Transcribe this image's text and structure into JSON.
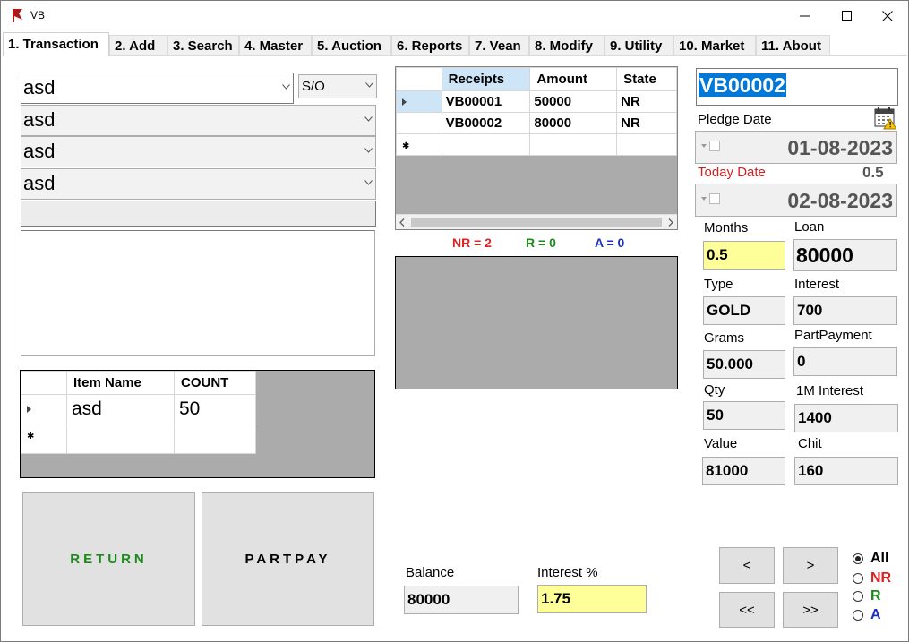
{
  "window": {
    "title": "VB",
    "minimize_glyph": "—",
    "maximize_glyph": "☐",
    "close_glyph": "✕"
  },
  "tabs": [
    {
      "label": "1. Transaction",
      "active": true
    },
    {
      "label": "2. Add"
    },
    {
      "label": "3. Search"
    },
    {
      "label": "4. Master"
    },
    {
      "label": "5. Auction"
    },
    {
      "label": "6. Reports"
    },
    {
      "label": "7. Vean"
    },
    {
      "label": "8. Modify"
    },
    {
      "label": "9. Utility"
    },
    {
      "label": "10. Market"
    },
    {
      "label": "11. About"
    }
  ],
  "customer": {
    "name": "asd",
    "relation": "S/O",
    "relative": "asd",
    "address": "asd",
    "place": "asd",
    "phone": "",
    "notes": ""
  },
  "items_grid": {
    "columns": [
      "Item Name",
      "COUNT"
    ],
    "rows": [
      [
        "asd",
        "50"
      ]
    ]
  },
  "buttons": {
    "return": "RETURN",
    "partpay": "PARTPAY",
    "prev": "<",
    "next": ">",
    "first": "<<",
    "last": ">>"
  },
  "receipts_grid": {
    "columns": [
      "Receipts",
      "Amount",
      "State"
    ],
    "rows": [
      [
        "VB00001",
        "50000",
        "NR"
      ],
      [
        "VB00002",
        "80000",
        "NR"
      ]
    ]
  },
  "counts": {
    "nr": "NR = 2",
    "r": "R = 0",
    "a": "A = 0"
  },
  "receipt_no": "VB00002",
  "pledge_date_label": "Pledge Date",
  "pledge_date": "01-08-2023",
  "today_date_label": "Today Date",
  "months_diff": "0.5",
  "today_date": "02-08-2023",
  "fields": {
    "months_label": "Months",
    "months": "0.5",
    "loan_label": "Loan",
    "loan": "80000",
    "type_label": "Type",
    "type": "GOLD",
    "interest_label": "Interest",
    "interest": "700",
    "grams_label": "Grams",
    "grams": "50.000",
    "partpayment_label": "PartPayment",
    "partpayment": "0",
    "qty_label": "Qty",
    "qty": "50",
    "m1_interest_label": "1M Interest",
    "m1_interest": "1400",
    "value_label": "Value",
    "value": "81000",
    "chit_label": "Chit",
    "chit": "160"
  },
  "balance_label": "Balance",
  "balance": "80000",
  "interest_pct_label": "Interest %",
  "interest_pct": "1.75",
  "filter": [
    {
      "label": "All",
      "checked": true,
      "color": "#000000"
    },
    {
      "label": "NR",
      "checked": false,
      "color": "#e02020"
    },
    {
      "label": "R",
      "checked": false,
      "color": "#1a8a1a"
    },
    {
      "label": "A",
      "checked": false,
      "color": "#1a2fc0"
    }
  ],
  "colors": {
    "nr": "#e02020",
    "r": "#1a8a1a",
    "a": "#1a2fc0",
    "selected": "#0078d7",
    "today_label": "#d02020",
    "yellow_field": "#ffff99"
  }
}
